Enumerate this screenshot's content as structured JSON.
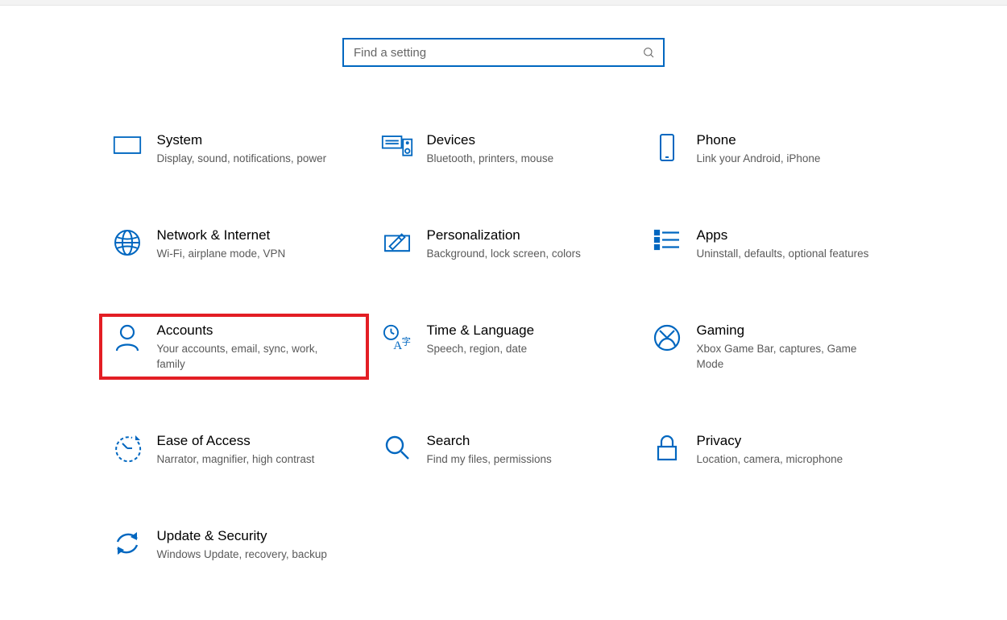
{
  "search": {
    "placeholder": "Find a setting"
  },
  "tiles": [
    {
      "id": "system",
      "title": "System",
      "desc": "Display, sound, notifications, power"
    },
    {
      "id": "devices",
      "title": "Devices",
      "desc": "Bluetooth, printers, mouse"
    },
    {
      "id": "phone",
      "title": "Phone",
      "desc": "Link your Android, iPhone"
    },
    {
      "id": "network",
      "title": "Network & Internet",
      "desc": "Wi-Fi, airplane mode, VPN"
    },
    {
      "id": "personalization",
      "title": "Personalization",
      "desc": "Background, lock screen, colors"
    },
    {
      "id": "apps",
      "title": "Apps",
      "desc": "Uninstall, defaults, optional features"
    },
    {
      "id": "accounts",
      "title": "Accounts",
      "desc": "Your accounts, email, sync, work, family"
    },
    {
      "id": "time",
      "title": "Time & Language",
      "desc": "Speech, region, date"
    },
    {
      "id": "gaming",
      "title": "Gaming",
      "desc": "Xbox Game Bar, captures, Game Mode"
    },
    {
      "id": "ease",
      "title": "Ease of Access",
      "desc": "Narrator, magnifier, high contrast"
    },
    {
      "id": "search",
      "title": "Search",
      "desc": "Find my files, permissions"
    },
    {
      "id": "privacy",
      "title": "Privacy",
      "desc": "Location, camera, microphone"
    },
    {
      "id": "update",
      "title": "Update & Security",
      "desc": "Windows Update, recovery, backup"
    }
  ],
  "highlighted": "accounts"
}
